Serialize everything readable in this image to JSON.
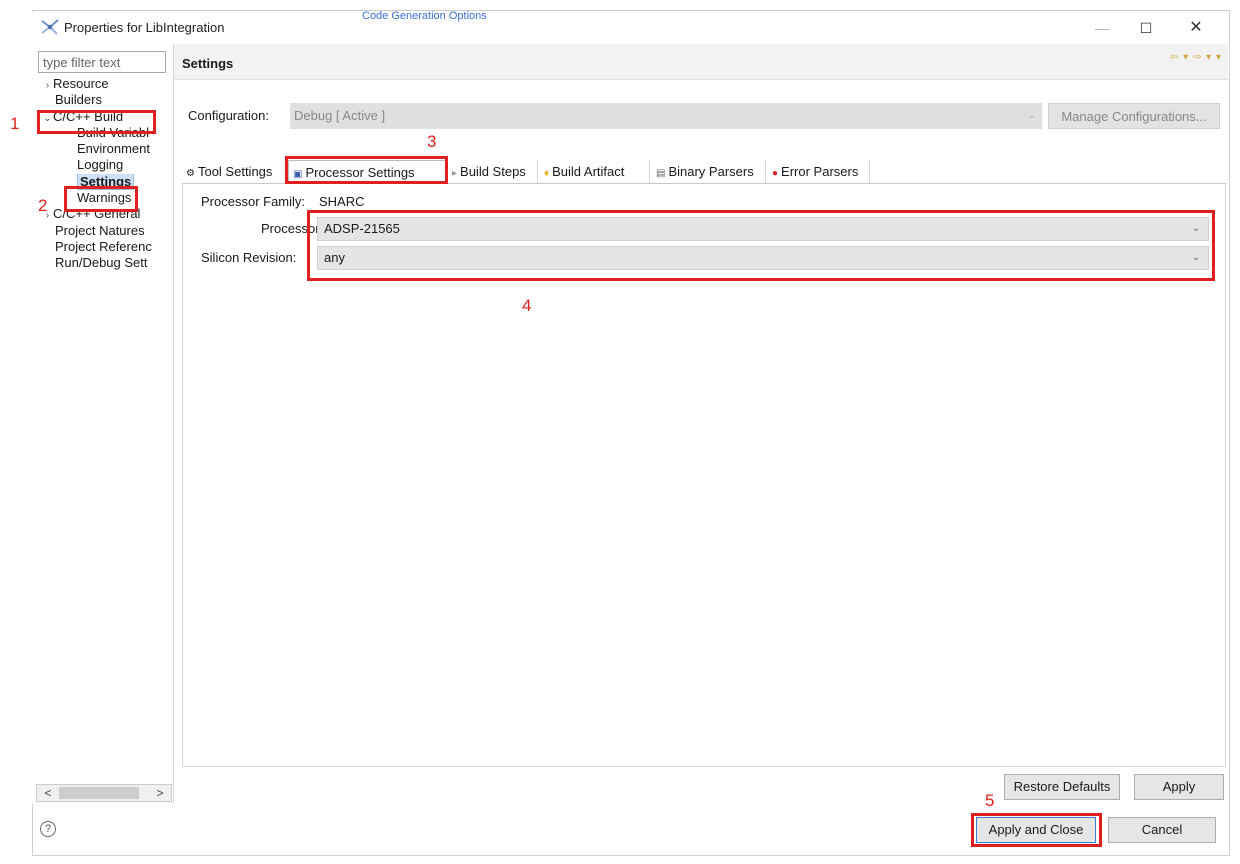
{
  "window": {
    "title": "Properties for LibIntegration",
    "stray_title": "Code Generation Options",
    "minimize": "—",
    "maximize": "☐",
    "close": "✕"
  },
  "filter": {
    "placeholder": "type filter text"
  },
  "tree": {
    "resource": "Resource",
    "builders": "Builders",
    "c_build": "C/C++ Build",
    "build_variables": "Build Variabl",
    "environment": "Environment",
    "logging": "Logging",
    "settings": "Settings",
    "warnings": "Warnings",
    "c_general": "C/C++ General",
    "project_natures": "Project Natures",
    "project_references": "Project Referenc",
    "run_debug": "Run/Debug Sett"
  },
  "header": {
    "title": "Settings"
  },
  "config": {
    "label": "Configuration:",
    "value": "Debug  [ Active ]",
    "manage_button": "Manage Configurations..."
  },
  "tabs": {
    "tool_settings": "Tool Settings",
    "processor_settings": "Processor Settings",
    "build_steps": "Build Steps",
    "build_artifact": "Build Artifact",
    "binary_parsers": "Binary Parsers",
    "error_parsers": "Error Parsers"
  },
  "processor": {
    "family_label": "Processor Family:",
    "family_value": "SHARC",
    "processor_label": "Processor:",
    "processor_value": "ADSP-21565",
    "silicon_label": "Silicon Revision:",
    "silicon_value": "any"
  },
  "buttons": {
    "restore_defaults": "Restore Defaults",
    "apply": "Apply",
    "apply_and_close": "Apply and Close",
    "cancel": "Cancel"
  },
  "scroll": {
    "left": "<",
    "right": ">"
  },
  "annotations": [
    "1",
    "2",
    "3",
    "4",
    "5"
  ],
  "colors": {
    "highlight": "#e02020",
    "selection": "#cde0f7",
    "accent": "#3a7fd6"
  }
}
